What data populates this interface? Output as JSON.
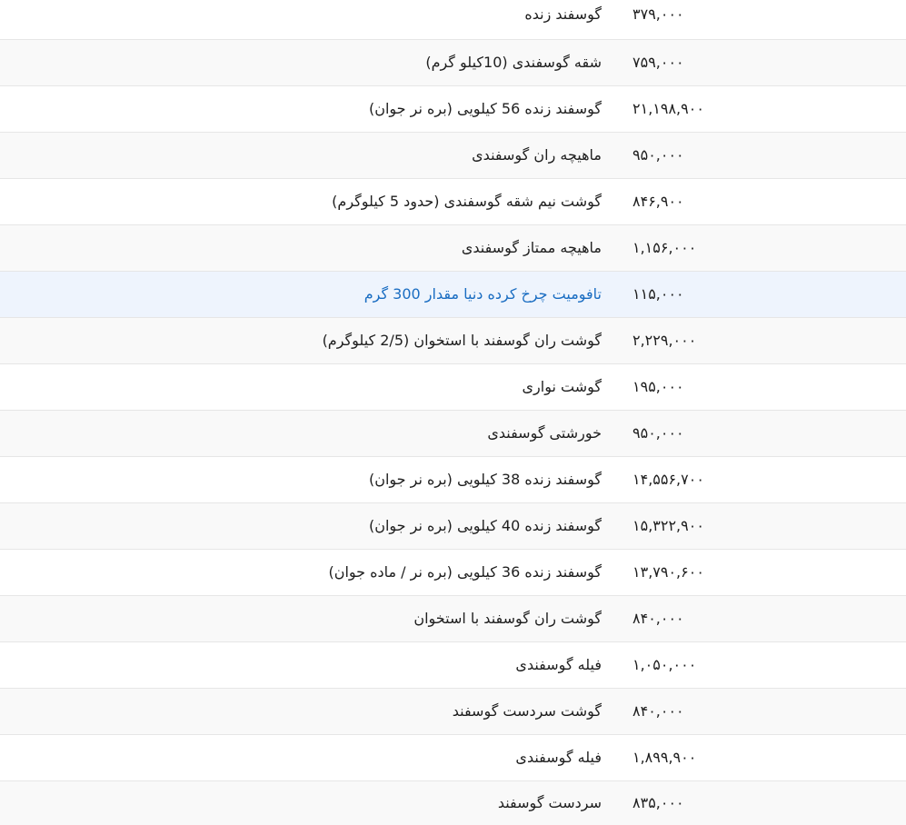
{
  "rows": [
    {
      "name": "گوسفند زنده",
      "price": "۳۷۹,۰۰۰"
    },
    {
      "name": "شقه گوسفندی (10کیلو گرم)",
      "price": "۷۵۹,۰۰۰"
    },
    {
      "name": "گوسفند زنده 56 کیلویی (بره نر جوان)",
      "price": "۲۱,۱۹۸,۹۰۰"
    },
    {
      "name": "ماهیچه ران گوسفندی",
      "price": "۹۵۰,۰۰۰"
    },
    {
      "name": "گوشت نیم شقه گوسفندی (حدود 5 کیلوگرم)",
      "price": "۸۴۶,۹۰۰"
    },
    {
      "name": "ماهیچه ممتاز گوسفندی",
      "price": "۱,۱۵۶,۰۰۰"
    },
    {
      "name": "تافومیت چرخ کرده دنیا مقدار 300 گرم",
      "price": "۱۱۵,۰۰۰",
      "highlight": true
    },
    {
      "name": "گوشت ران گوسفند با استخوان (2/5 کیلوگرم)",
      "price": "۲,۲۲۹,۰۰۰"
    },
    {
      "name": "گوشت نواری",
      "price": "۱۹۵,۰۰۰"
    },
    {
      "name": "خورشتی گوسفندی",
      "price": "۹۵۰,۰۰۰"
    },
    {
      "name": "گوسفند زنده 38 کیلویی (بره نر جوان)",
      "price": "۱۴,۵۵۶,۷۰۰"
    },
    {
      "name": "گوسفند زنده 40 کیلویی (بره نر جوان)",
      "price": "۱۵,۳۲۲,۹۰۰"
    },
    {
      "name": "گوسفند زنده 36 کیلویی (بره نر / ماده جوان)",
      "price": "۱۳,۷۹۰,۶۰۰"
    },
    {
      "name": "گوشت ران گوسفند با استخوان",
      "price": "۸۴۰,۰۰۰"
    },
    {
      "name": "فیله گوسفندی",
      "price": "۱,۰۵۰,۰۰۰"
    },
    {
      "name": "گوشت سردست گوسفند",
      "price": "۸۴۰,۰۰۰"
    },
    {
      "name": "فیله گوسفندی",
      "price": "۱,۸۹۹,۹۰۰"
    },
    {
      "name": "سردست گوسفند",
      "price": "۸۳۵,۰۰۰"
    }
  ],
  "colors": {
    "highlight_row": "#eef4fd",
    "link": "#1a6dc2",
    "stripe": "#f9f9f9",
    "border": "#e6e6e6"
  }
}
